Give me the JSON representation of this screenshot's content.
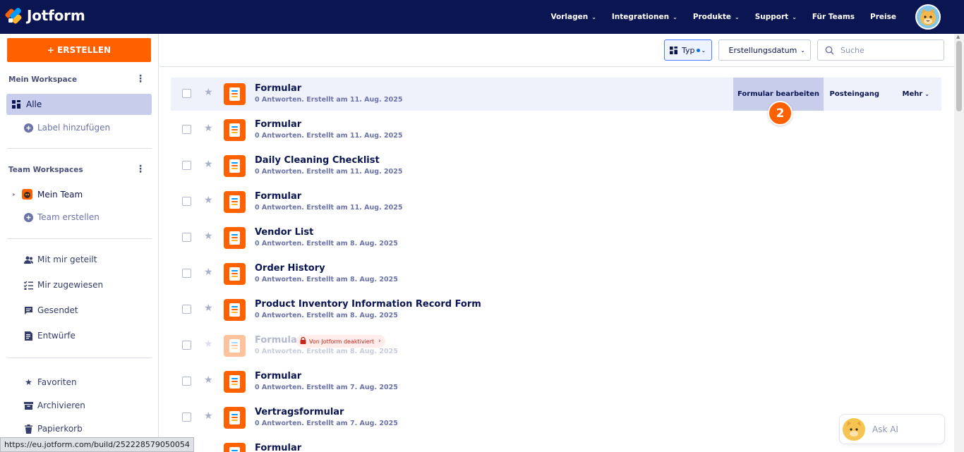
{
  "brand": {
    "name": "Jotform"
  },
  "nav": {
    "items": [
      {
        "label": "Vorlagen",
        "dropdown": true
      },
      {
        "label": "Integrationen",
        "dropdown": true
      },
      {
        "label": "Produkte",
        "dropdown": true
      },
      {
        "label": "Support",
        "dropdown": true
      },
      {
        "label": "Für Teams",
        "dropdown": false
      },
      {
        "label": "Preise",
        "dropdown": false
      }
    ]
  },
  "sidebar": {
    "create_label": "+ ERSTELLEN",
    "my_workspace": {
      "title": "Mein Workspace",
      "active_label": "Alle",
      "add_label": "Label hinzufügen"
    },
    "team_workspaces": {
      "title": "Team Workspaces",
      "team_name": "Mein Team",
      "create_team": "Team erstellen"
    },
    "shared": [
      {
        "label": "Mit mir geteilt",
        "icon": "people-icon"
      },
      {
        "label": "Mir zugewiesen",
        "icon": "checklist-icon"
      },
      {
        "label": "Gesendet",
        "icon": "chat-icon"
      },
      {
        "label": "Entwürfe",
        "icon": "draft-icon"
      }
    ],
    "other": [
      {
        "label": "Favoriten",
        "icon": "star-icon"
      },
      {
        "label": "Archivieren",
        "icon": "archive-icon"
      },
      {
        "label": "Papierkorb",
        "icon": "trash-icon"
      }
    ]
  },
  "toolbar": {
    "type_label": "Typ",
    "sort_label": "Erstellungsdatum",
    "search_placeholder": "Suche"
  },
  "row_actions": {
    "edit": "Formular bearbeiten",
    "inbox": "Posteingang",
    "more": "Mehr"
  },
  "step_badge": "2",
  "forms": [
    {
      "title": "Formular",
      "subtitle": "0 Antworten. Erstellt am 11. Aug. 2025",
      "highlighted": true
    },
    {
      "title": "Formular",
      "subtitle": "0 Antworten. Erstellt am 11. Aug. 2025"
    },
    {
      "title": "Daily Cleaning Checklist",
      "subtitle": "0 Antworten. Erstellt am 11. Aug. 2025"
    },
    {
      "title": "Formular",
      "subtitle": "0 Antworten. Erstellt am 11. Aug. 2025"
    },
    {
      "title": "Vendor List",
      "subtitle": "0 Antworten. Erstellt am 8. Aug. 2025"
    },
    {
      "title": "Order History",
      "subtitle": "0 Antworten. Erstellt am 8. Aug. 2025"
    },
    {
      "title": "Product Inventory Information Record Form",
      "subtitle": "0 Antworten. Erstellt am 8. Aug. 2025"
    },
    {
      "title": "Formular",
      "subtitle": "0 Antworten. Erstellt am 8. Aug. 2025",
      "disabled": true,
      "badge": "Von Jotform deaktiviert"
    },
    {
      "title": "Formular",
      "subtitle": "0 Antworten. Erstellt am 7. Aug. 2025"
    },
    {
      "title": "Vertragsformular",
      "subtitle": "0 Antworten. Erstellt am 7. Aug. 2025"
    },
    {
      "title": "Formular",
      "subtitle": ""
    }
  ],
  "ask_ai": {
    "label": "Ask AI"
  },
  "status_url": "https://eu.jotform.com/build/252228579050054",
  "colors": {
    "topbar": "#0a1551",
    "accent": "#ff6100",
    "active": "#c8cdec"
  }
}
